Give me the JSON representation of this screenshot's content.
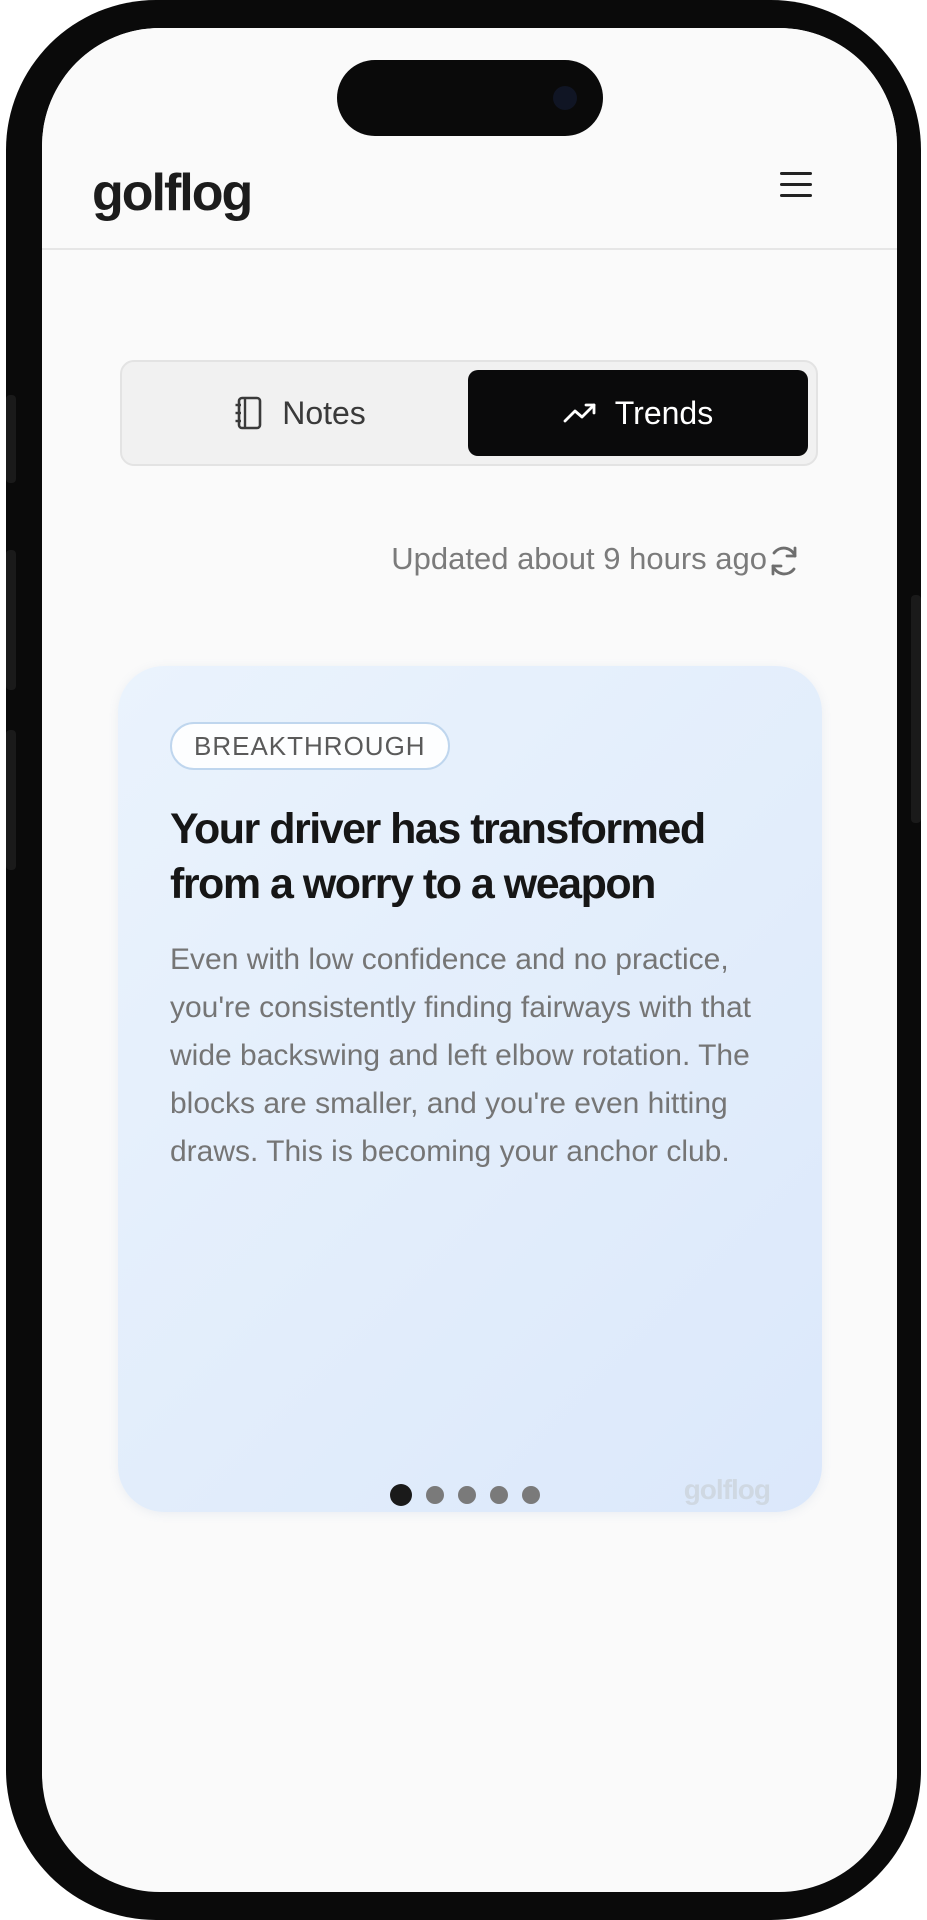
{
  "app": {
    "logo": "golflog",
    "menu_icon": "hamburger-menu-icon"
  },
  "tabs": [
    {
      "label": "Notes",
      "icon": "notebook-icon",
      "selected": false
    },
    {
      "label": "Trends",
      "icon": "trending-up-icon",
      "selected": true
    }
  ],
  "status": {
    "updated_text": "Updated about 9 hours ago",
    "refresh_icon": "refresh-icon"
  },
  "insight": {
    "badge": "BREAKTHROUGH",
    "title": "Your driver has transformed from a worry to a weapon",
    "body": "Even with low confidence and no practice, you're consistently finding fairways with that wide backswing and left elbow rotation. The blocks are smaller, and you're even hitting draws. This is becoming your anchor club.",
    "watermark": "golflog",
    "pagination": {
      "count": 5,
      "active_index": 0
    }
  },
  "colors": {
    "accent_dark": "#0a0a0b",
    "card_gradient_start": "#eaf3fd",
    "card_gradient_end": "#dbe8fb",
    "muted_text": "#757575"
  }
}
